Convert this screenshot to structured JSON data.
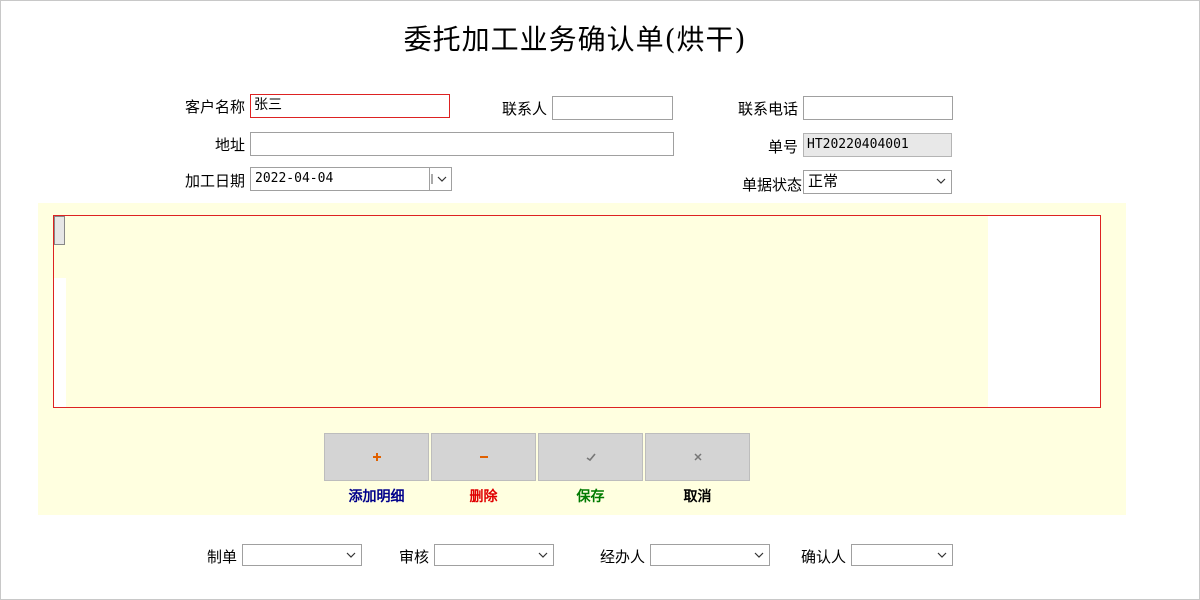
{
  "title": "委托加工业务确认单(烘干)",
  "form": {
    "customer_label": "客户名称",
    "customer_value": "张三",
    "contact_label": "联系人",
    "contact_value": "",
    "phone_label": "联系电话",
    "phone_value": "",
    "address_label": "地址",
    "address_value": "",
    "order_no_label": "单号",
    "order_no_value": "HT20220404001",
    "date_label": "加工日期",
    "date_value": "2022-04-04",
    "status_label": "单据状态",
    "status_value": "正常"
  },
  "actions": {
    "add": {
      "icon": "plus-icon",
      "label": "添加明细",
      "color": "#00008b"
    },
    "delete": {
      "icon": "minus-icon",
      "label": "删除",
      "color": "#e00000"
    },
    "save": {
      "icon": "check-icon",
      "label": "保存",
      "color": "#007a00"
    },
    "cancel": {
      "icon": "close-icon",
      "label": "取消",
      "color": "#000000"
    }
  },
  "footer": {
    "maker_label": "制单",
    "maker_value": "",
    "auditor_label": "审核",
    "auditor_value": "",
    "handler_label": "经办人",
    "handler_value": "",
    "confirmer_label": "确认人",
    "confirmer_value": ""
  },
  "colors": {
    "panel_bg": "#ffffe0",
    "required_border": "#dd2222",
    "button_bg": "#d4d4d4"
  }
}
